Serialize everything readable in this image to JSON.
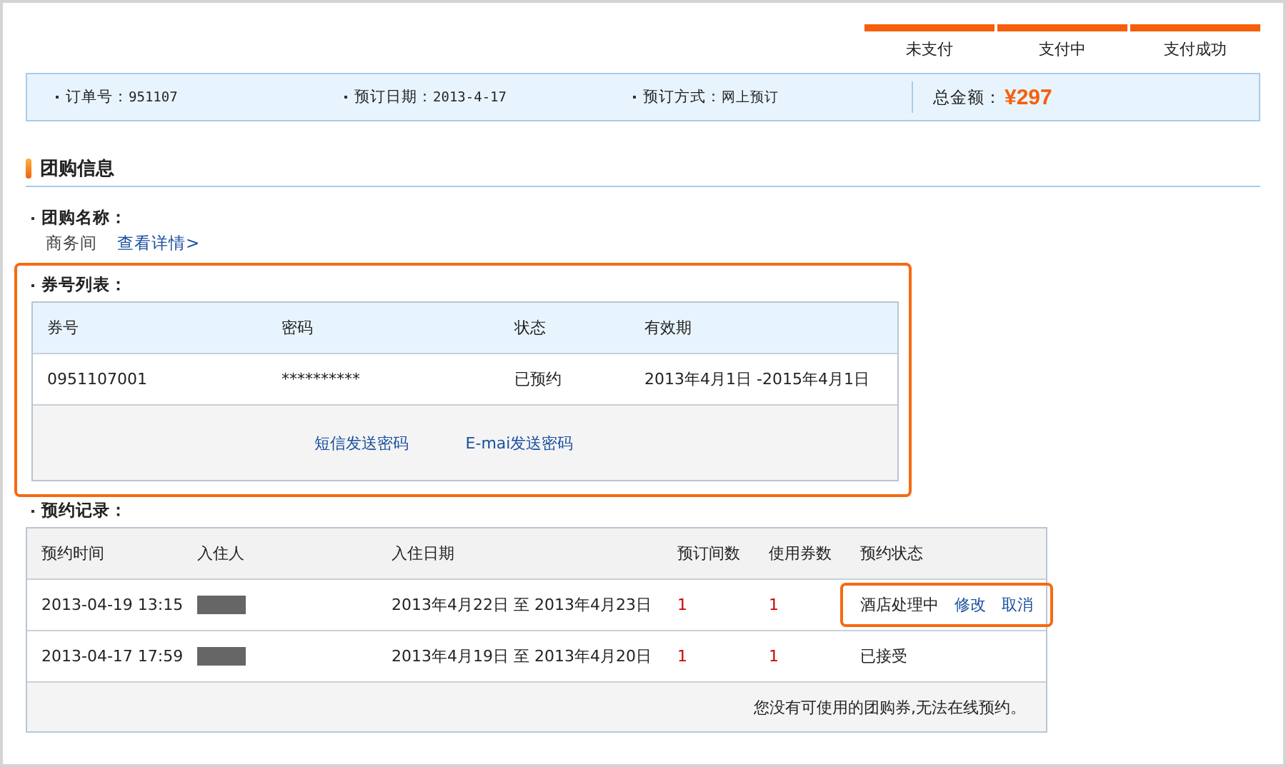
{
  "steps": [
    {
      "label": "未支付",
      "done": true
    },
    {
      "label": "支付中",
      "done": true
    },
    {
      "label": "支付成功",
      "done": true
    }
  ],
  "order": {
    "fields": [
      {
        "label": "订单号：",
        "value": "951107"
      },
      {
        "label": "预订日期：",
        "value": "2013-4-17"
      },
      {
        "label": "预订方式：",
        "value": "网上预订"
      }
    ],
    "total_label": "总金额：",
    "total": "¥297"
  },
  "section_title": "团购信息",
  "deal": {
    "label": "团购名称：",
    "name": "商务间",
    "link": "查看详情>"
  },
  "coupons": {
    "label": "券号列表：",
    "highlighted": true,
    "columns": [
      "券号",
      "密码",
      "状态",
      "有效期"
    ],
    "rows": [
      [
        "0951107001",
        "**********",
        "已预约",
        "2013年4月1日 -2015年4月1日"
      ]
    ],
    "actions": [
      "短信发送密码",
      "E-mai发送密码"
    ]
  },
  "reservations": {
    "label": "预约记录：",
    "columns": [
      "预约时间",
      "入住人",
      "入住日期",
      "预订间数",
      "使用券数",
      "预约状态"
    ],
    "rows": [
      {
        "time": "2013-04-19 13:15",
        "guest_redacted": true,
        "dates": "2013年4月22日 至 2013年4月23日",
        "rooms": "1",
        "coupons": "1",
        "status": "酒店处理中",
        "actions": [
          "修改",
          "取消"
        ],
        "highlighted": true
      },
      {
        "time": "2013-04-17 17:59",
        "guest_redacted": true,
        "dates": "2013年4月19日 至 2013年4月20日",
        "rooms": "1",
        "coupons": "1",
        "status": "已接受",
        "actions": [],
        "highlighted": false
      }
    ],
    "note": "您没有可使用的团购券,无法在线预约。"
  }
}
